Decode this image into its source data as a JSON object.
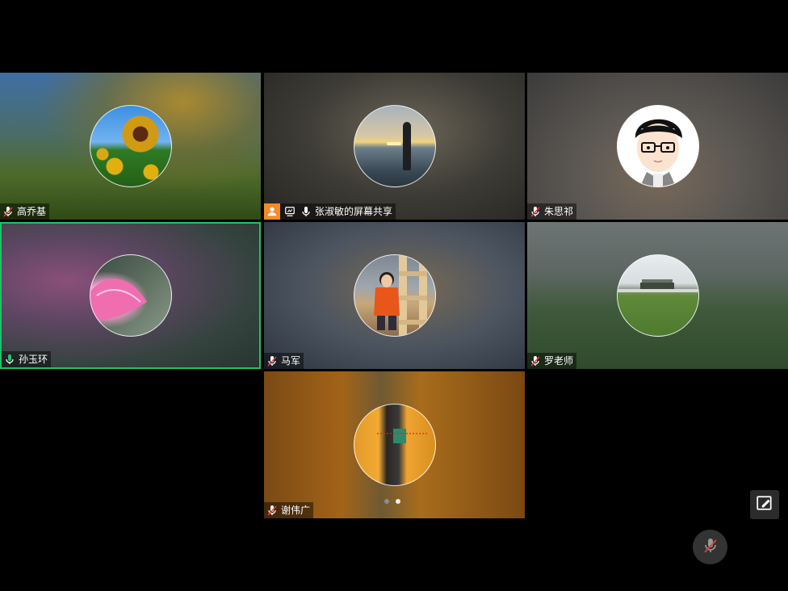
{
  "participants": [
    {
      "name": "高乔基",
      "mic": "muted"
    },
    {
      "name": "张淑敏的屏幕共享",
      "mic": "on",
      "sharing": true
    },
    {
      "name": "朱思祁",
      "mic": "muted"
    },
    {
      "name": "孙玉环",
      "mic": "speaking",
      "active": true
    },
    {
      "name": "马军",
      "mic": "muted"
    },
    {
      "name": "罗老师",
      "mic": "muted"
    },
    {
      "name": "谢伟广",
      "mic": "muted"
    }
  ],
  "pagination": {
    "pages": 2,
    "current": 2
  },
  "colors": {
    "active_border": "#1ec26a",
    "share_badge": "#f28c28",
    "muted_mic": "#e0413b"
  },
  "icons": {
    "float_button": "edit-window-icon",
    "mic_fab": "mic-muted-icon"
  }
}
